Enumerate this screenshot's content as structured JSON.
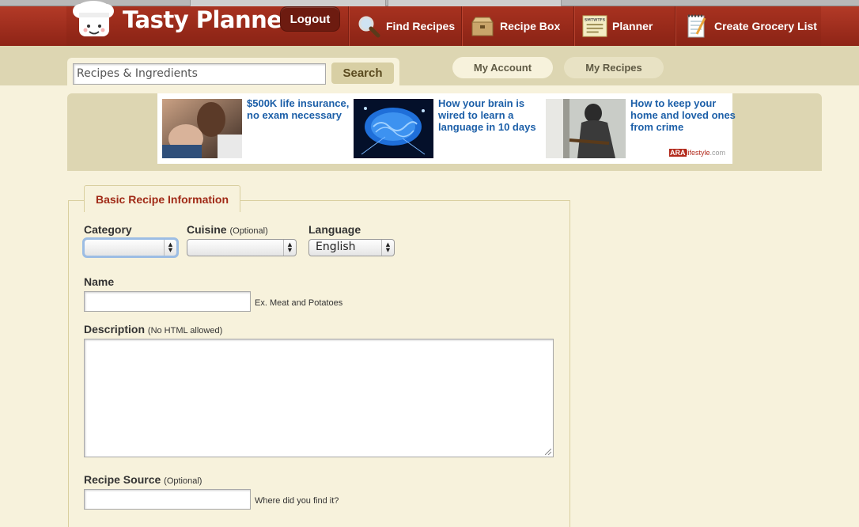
{
  "header": {
    "logo_text": "Tasty Planner",
    "logout_label": "Logout",
    "nav": [
      {
        "label": "Find Recipes",
        "icon": "magnifier-icon"
      },
      {
        "label": "Recipe Box",
        "icon": "box-icon"
      },
      {
        "label": "Planner",
        "icon": "calendar-icon",
        "calendar_days": "SMTWTFS"
      },
      {
        "label": "Create Grocery List",
        "icon": "notepad-icon"
      }
    ]
  },
  "search": {
    "placeholder": "Recipes & Ingredients",
    "button_label": "Search"
  },
  "account_links": {
    "my_account": "My Account",
    "my_recipes": "My Recipes"
  },
  "ads": [
    {
      "text": "$500K life insurance, no exam necessary"
    },
    {
      "text": "How your brain is wired to learn a language in 10 days"
    },
    {
      "text": "How to keep your home and loved ones from crime"
    }
  ],
  "ad_brand": {
    "ara": "ARA",
    "rest": "lifestyle",
    "suffix": ".com"
  },
  "form": {
    "tab_label": "Basic Recipe Information",
    "category": {
      "label": "Category",
      "value": ""
    },
    "cuisine": {
      "label": "Cuisine",
      "optional": "(Optional)",
      "value": ""
    },
    "language": {
      "label": "Language",
      "value": "English"
    },
    "name": {
      "label": "Name",
      "hint": "Ex. Meat and Potatoes",
      "value": ""
    },
    "description": {
      "label": "Description",
      "note": "(No HTML allowed)",
      "value": ""
    },
    "source": {
      "label": "Recipe Source",
      "optional": "(Optional)",
      "hint": "Where did you find it?",
      "value": ""
    }
  },
  "colors": {
    "header_red": "#9c2b1b",
    "link_blue": "#1c5fa8",
    "tab_red": "#a02a17",
    "band_tan": "#ddd6b2",
    "page_cream": "#f7f2dc"
  }
}
